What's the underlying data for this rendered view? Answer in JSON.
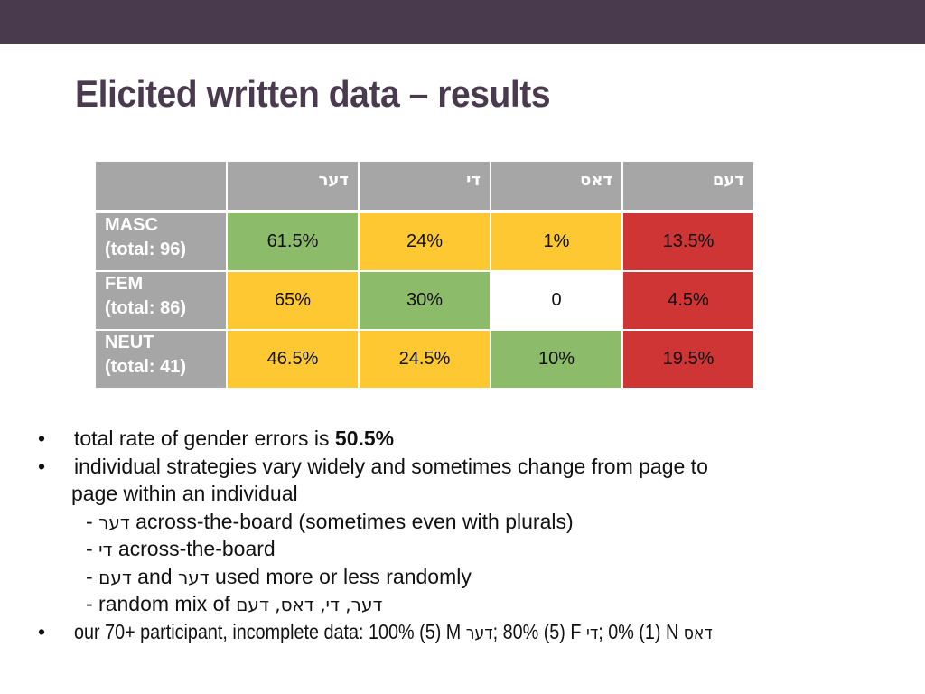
{
  "slide": {
    "title": "Elicited written data – results",
    "theme_color": "#4a3a4e"
  },
  "table": {
    "columns": [
      "",
      "דער",
      "די",
      "דאס",
      "דעם"
    ],
    "rows": [
      {
        "label": "MASC",
        "total": "(total: 96)",
        "cells": [
          {
            "value": "61.5%",
            "color": "green"
          },
          {
            "value": "24%",
            "color": "yellow"
          },
          {
            "value": "1%",
            "color": "yellow"
          },
          {
            "value": "13.5%",
            "color": "red"
          }
        ]
      },
      {
        "label": "FEM",
        "total": "(total: 86)",
        "cells": [
          {
            "value": "65%",
            "color": "yellow"
          },
          {
            "value": "30%",
            "color": "green"
          },
          {
            "value": "0",
            "color": "white"
          },
          {
            "value": "4.5%",
            "color": "red"
          }
        ]
      },
      {
        "label": "NEUT",
        "total": "(total: 41)",
        "cells": [
          {
            "value": "46.5%",
            "color": "yellow"
          },
          {
            "value": "24.5%",
            "color": "yellow"
          },
          {
            "value": "10%",
            "color": "green"
          },
          {
            "value": "19.5%",
            "color": "red"
          }
        ]
      }
    ],
    "colors": {
      "header": "#a6a6a6",
      "green": "#8cbb6a",
      "yellow": "#fec832",
      "red": "#d03535",
      "white": "#ffffff"
    }
  },
  "bullets": {
    "b1_pre": "total rate of gender errors is ",
    "b1_bold": "50.5%",
    "b2_line1": "individual strategies vary widely and sometimes change from page to",
    "b2_line2": "page within an individual",
    "sub1_dash": "- ",
    "sub1_heb": "דער",
    "sub1_text": " across-the-board (sometimes even with plurals)",
    "sub2_dash": "- ",
    "sub2_heb": "די",
    "sub2_text": " across-the-board",
    "sub3_dash": "- ",
    "sub3_heb1": "דעם",
    "sub3_and": " and ",
    "sub3_heb2": "דער",
    "sub3_text": " used more or less randomly",
    "sub4_text": "- random mix of ",
    "sub4_heb": "דער, די, דאס, דעם",
    "b3_pre": "our 70+ participant, incomplete data: 100% (5) M ",
    "b3_heb1": "דער",
    "b3_mid1": "; 80% (5) F ",
    "b3_heb2": "די",
    "b3_mid2": "; 0% (1) N ",
    "b3_heb3": "דאס",
    "bullet_glyph": "•"
  }
}
